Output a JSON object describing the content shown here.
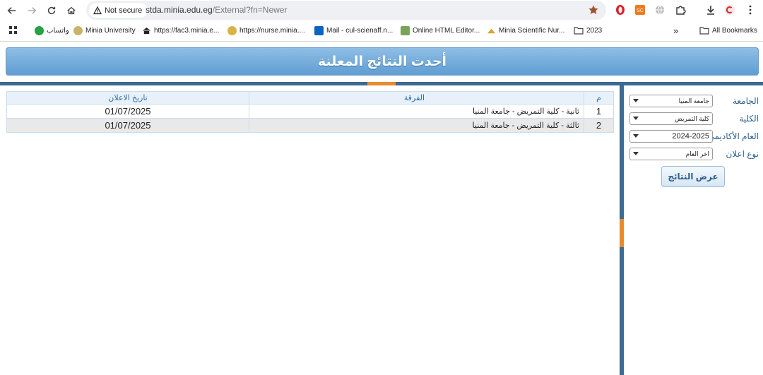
{
  "browser": {
    "security_label": "Not secure",
    "url_host": "stda.minia.edu.eg",
    "url_path": "/External?fn=Newer",
    "bookmarks": [
      "واتساب",
      "Minia University",
      "https://fac3.minia.e...",
      "https://nurse.minia....",
      "Mail - cul-scienaff.n...",
      "Online HTML Editor...",
      "Minia Scientific Nur...",
      "2023"
    ],
    "more_label": "»",
    "all_bookmarks_label": "All Bookmarks"
  },
  "page": {
    "title": "أحدث النتائج المعلنة",
    "table": {
      "headers": {
        "num": "م",
        "level": "الفرقة",
        "date": "تاريخ الاعلان"
      },
      "rows": [
        {
          "num": "1",
          "level": "ثانية - كلية التمريض - جامعة المنيا",
          "date": "01/07/2025"
        },
        {
          "num": "2",
          "level": "ثالثة - كلية التمريض - جامعة المنيا",
          "date": "01/07/2025"
        }
      ]
    },
    "filters": {
      "university_label": "الجامعة",
      "university_value": "جامعة المنيا",
      "faculty_label": "الكلية",
      "faculty_value": "كلية التمريض",
      "year_label": "العام الأكاديمي",
      "year_value": "2024-2025",
      "type_label": "نوع اعلان",
      "type_value": "اخر العام",
      "show_button": "عرض النتائج"
    }
  },
  "colors": {
    "header_top": "#8fbee5",
    "header_bottom": "#5f9dd2",
    "rail": "#3b6a94",
    "accent": "#e88a2e"
  }
}
